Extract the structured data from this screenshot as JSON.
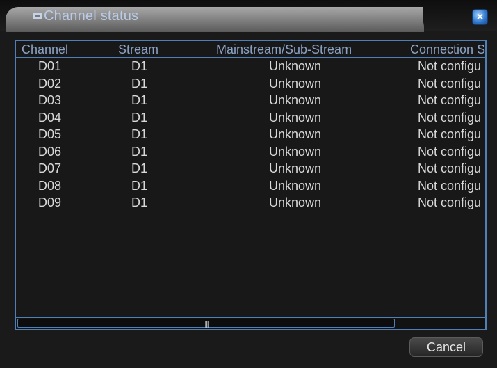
{
  "window": {
    "title": "Channel status",
    "close_label": "×"
  },
  "table": {
    "headers": [
      "Channel",
      "Stream",
      "Mainstream/Sub-Stream",
      "Connection S"
    ],
    "rows": [
      [
        "D01",
        "D1",
        "Unknown",
        "Not configu"
      ],
      [
        "D02",
        "D1",
        "Unknown",
        "Not configu"
      ],
      [
        "D03",
        "D1",
        "Unknown",
        "Not configu"
      ],
      [
        "D04",
        "D1",
        "Unknown",
        "Not configu"
      ],
      [
        "D05",
        "D1",
        "Unknown",
        "Not configu"
      ],
      [
        "D06",
        "D1",
        "Unknown",
        "Not configu"
      ],
      [
        "D07",
        "D1",
        "Unknown",
        "Not configu"
      ],
      [
        "D08",
        "D1",
        "Unknown",
        "Not configu"
      ],
      [
        "D09",
        "D1",
        "Unknown",
        "Not configu"
      ]
    ]
  },
  "scrollbar": {
    "grip": "|||"
  },
  "buttons": {
    "cancel": "Cancel"
  },
  "colors": {
    "accent": "#4e7fb6",
    "header_text": "#8aa2c6",
    "row_text": "#d8d8d8",
    "background": "#1a1a1a"
  },
  "icons": {
    "title": "window-icon",
    "close": "close-icon"
  }
}
